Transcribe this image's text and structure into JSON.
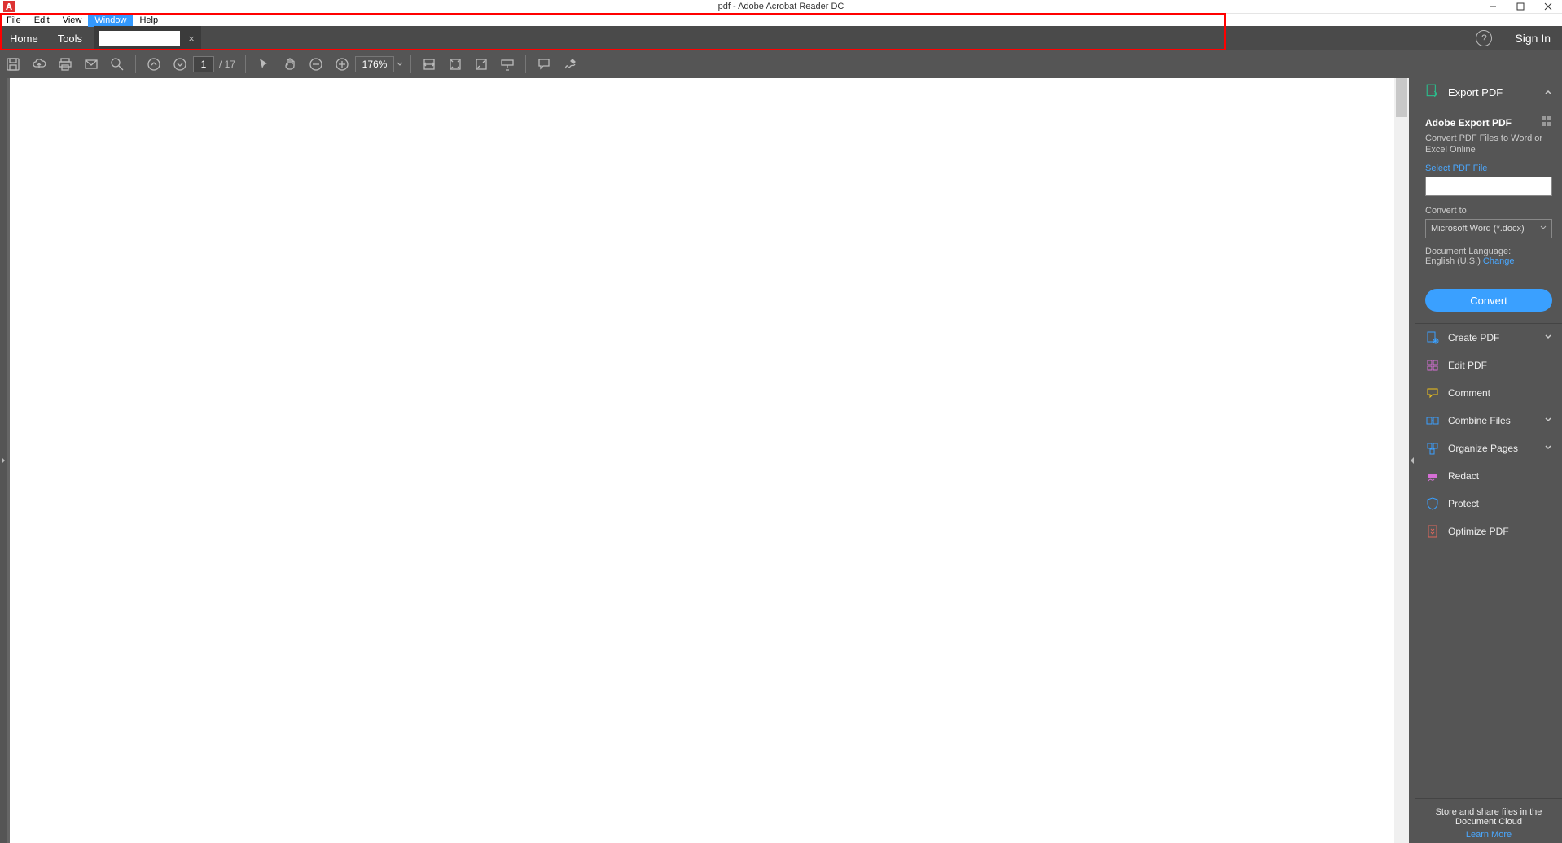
{
  "titlebar": {
    "title": "pdf - Adobe Acrobat Reader DC"
  },
  "menubar": {
    "items": [
      "File",
      "Edit",
      "View",
      "Window",
      "Help"
    ],
    "highlight_index": 3
  },
  "tabbar": {
    "home": "Home",
    "tools": "Tools",
    "sign_in": "Sign In"
  },
  "toolbar": {
    "page_current": "1",
    "page_total": "/ 17",
    "zoom": "176%"
  },
  "right_panel": {
    "export_pdf": {
      "title": "Export PDF",
      "heading": "Adobe Export PDF",
      "desc": "Convert PDF Files to Word or Excel Online",
      "select_label": "Select PDF File",
      "convert_to_label": "Convert to",
      "convert_to_value": "Microsoft Word (*.docx)",
      "doc_lang_label": "Document Language:",
      "doc_lang_value": "English (U.S.)",
      "change": "Change",
      "convert_btn": "Convert"
    },
    "tools": [
      {
        "label": "Create PDF",
        "icon": "create",
        "chevron": true,
        "color": "#3aa0ff"
      },
      {
        "label": "Edit PDF",
        "icon": "edit",
        "chevron": false,
        "color": "#d66fd6"
      },
      {
        "label": "Comment",
        "icon": "comment",
        "chevron": false,
        "color": "#f5c518"
      },
      {
        "label": "Combine Files",
        "icon": "combine",
        "chevron": true,
        "color": "#3aa0ff"
      },
      {
        "label": "Organize Pages",
        "icon": "organize",
        "chevron": true,
        "color": "#3aa0ff"
      },
      {
        "label": "Redact",
        "icon": "redact",
        "chevron": false,
        "color": "#d66fd6"
      },
      {
        "label": "Protect",
        "icon": "protect",
        "chevron": false,
        "color": "#3aa0ff"
      },
      {
        "label": "Optimize PDF",
        "icon": "optimize",
        "chevron": false,
        "color": "#e0675b"
      }
    ],
    "footer": {
      "text": "Store and share files in the Document Cloud",
      "learn": "Learn More"
    }
  }
}
